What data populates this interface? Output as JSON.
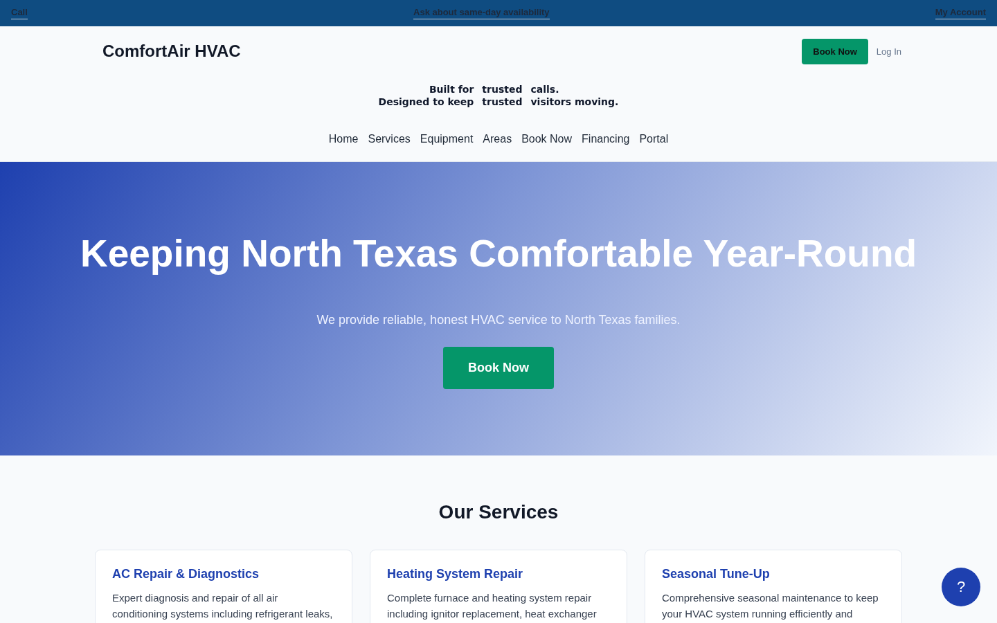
{
  "top_bar": {
    "left_link": "Call",
    "center_link": "Ask about same-day availability",
    "right_link": "My Account"
  },
  "header": {
    "logo": "ComfortAir HVAC",
    "book_button": "Book Now",
    "login_link": "Log In"
  },
  "tagline": [
    [
      "Built for",
      "trusted",
      "calls."
    ],
    [
      "Designed to keep",
      "trusted",
      "visitors moving."
    ]
  ],
  "nav": [
    "Home",
    "Services",
    "Equipment",
    "Areas",
    "Book Now",
    "Financing",
    "Portal"
  ],
  "hero": {
    "title": "Keeping North Texas Comfortable Year-Round",
    "subtitle": "We provide reliable, honest HVAC service to North Texas families.",
    "button": "Book Now"
  },
  "services": {
    "title": "Our Services",
    "cards": [
      {
        "title": "AC Repair & Diagnostics",
        "text": "Expert diagnosis and repair of all air conditioning systems including refrigerant leaks,"
      },
      {
        "title": "Heating System Repair",
        "text": "Complete furnace and heating system repair including ignitor replacement, heat exchanger"
      },
      {
        "title": "Seasonal Tune-Up",
        "text": "Comprehensive seasonal maintenance to keep your HVAC system running efficiently and"
      }
    ]
  },
  "help_button": "?"
}
